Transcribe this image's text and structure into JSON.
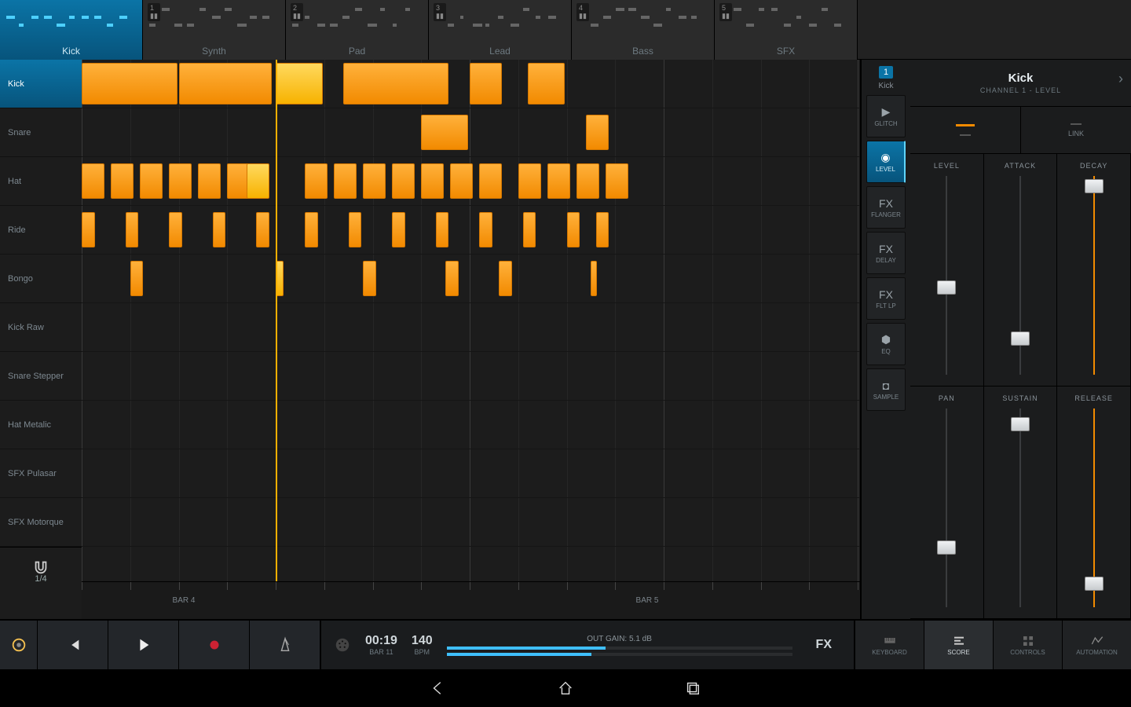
{
  "tracks": [
    "Kick",
    "Synth",
    "Pad",
    "Lead",
    "Bass",
    "SFX"
  ],
  "activeTrack": 0,
  "lanes": [
    "Kick",
    "Snare",
    "Hat",
    "Ride",
    "Bongo",
    "Kick Raw",
    "Snare Stepper",
    "Hat Metalic",
    "SFX Pulasar",
    "SFX Motorque"
  ],
  "activeLane": 0,
  "snap": "1/4",
  "ruler": {
    "labels": [
      "BAR  4",
      "BAR  5"
    ],
    "positions": [
      130,
      720
    ]
  },
  "playheadX": 247,
  "gridWidth": 988,
  "beats": 16,
  "stepWidth": 61.75,
  "steps": {
    "Kick": [
      {
        "i": 0,
        "w": 2
      },
      {
        "i": 2,
        "w": 2,
        "gap": 5
      },
      {
        "i": 4,
        "w": 1,
        "hi": true
      },
      {
        "i": 5.4,
        "w": 2.2
      },
      {
        "i": 8,
        "w": 0.7
      },
      {
        "i": 9.2,
        "w": 0.8
      }
    ],
    "Snare": [
      {
        "i": 7,
        "w": 1
      },
      {
        "i": 10.4,
        "w": 0.5
      }
    ],
    "Hat": [
      {
        "i": 0,
        "w": 0.5
      },
      {
        "i": 0.6,
        "w": 0.5
      },
      {
        "i": 1.2,
        "w": 0.5
      },
      {
        "i": 1.8,
        "w": 0.5
      },
      {
        "i": 2.4,
        "w": 0.5
      },
      {
        "i": 3,
        "w": 0.5
      },
      {
        "i": 3.4,
        "w": 0.5,
        "hi": true
      },
      {
        "i": 4.6,
        "w": 0.5
      },
      {
        "i": 5.2,
        "w": 0.5
      },
      {
        "i": 5.8,
        "w": 0.5
      },
      {
        "i": 6.4,
        "w": 0.5
      },
      {
        "i": 7,
        "w": 0.5
      },
      {
        "i": 7.6,
        "w": 0.5
      },
      {
        "i": 8.2,
        "w": 0.5
      },
      {
        "i": 9,
        "w": 0.5
      },
      {
        "i": 9.6,
        "w": 0.5
      },
      {
        "i": 10.2,
        "w": 0.5
      },
      {
        "i": 10.8,
        "w": 0.5
      }
    ],
    "Ride": [
      {
        "i": 0,
        "w": 0.3
      },
      {
        "i": 0.9,
        "w": 0.3
      },
      {
        "i": 1.8,
        "w": 0.3
      },
      {
        "i": 2.7,
        "w": 0.3
      },
      {
        "i": 3.6,
        "w": 0.3
      },
      {
        "i": 4.6,
        "w": 0.3
      },
      {
        "i": 5.5,
        "w": 0.3
      },
      {
        "i": 6.4,
        "w": 0.3
      },
      {
        "i": 7.3,
        "w": 0.3
      },
      {
        "i": 8.2,
        "w": 0.3
      },
      {
        "i": 9.1,
        "w": 0.3
      },
      {
        "i": 10,
        "w": 0.3
      },
      {
        "i": 10.6,
        "w": 0.3
      }
    ],
    "Bongo": [
      {
        "i": 1,
        "w": 0.3
      },
      {
        "i": 4,
        "w": 0.2,
        "hi": true
      },
      {
        "i": 5.8,
        "w": 0.3
      },
      {
        "i": 7.5,
        "w": 0.3
      },
      {
        "i": 8.6,
        "w": 0.3
      },
      {
        "i": 10.5,
        "w": 0.15
      }
    ]
  },
  "channel": {
    "number": "1",
    "name": "Kick"
  },
  "chanButtons": [
    {
      "id": "glitch",
      "label": "GLITCH",
      "icon": "▶"
    },
    {
      "id": "level",
      "label": "LEVEL",
      "icon": "◉",
      "selected": true
    },
    {
      "id": "fx-flanger",
      "label": "FLANGER",
      "icon": "FX"
    },
    {
      "id": "fx-delay",
      "label": "DELAY",
      "icon": "FX"
    },
    {
      "id": "fx-fltlp",
      "label": "FLT LP",
      "icon": "FX"
    },
    {
      "id": "eq",
      "label": "EQ",
      "icon": "⬢"
    },
    {
      "id": "sample",
      "label": "SAMPLE",
      "icon": "◘"
    }
  ],
  "paramPanel": {
    "title": "Kick",
    "subtitle": "CHANNEL 1 - LEVEL",
    "linkLabel": "LINK",
    "sliders": [
      {
        "name": "LEVEL",
        "pos": 0.44
      },
      {
        "name": "ATTACK",
        "pos": 0.18
      },
      {
        "name": "DECAY",
        "pos": 0.95,
        "orange": true
      },
      {
        "name": "PAN",
        "pos": 0.3
      },
      {
        "name": "SUSTAIN",
        "pos": 0.92
      },
      {
        "name": "RELEASE",
        "pos": 0.12,
        "orange": true
      }
    ]
  },
  "transport": {
    "time": "00:19",
    "timeSub": "BAR  11",
    "bpm": "140",
    "bpmSub": "BPM",
    "gainLabel": "OUT  GAIN:  5.1 dB",
    "fx": "FX",
    "views": [
      "KEYBOARD",
      "SCORE",
      "CONTROLS",
      "AUTOMATION"
    ],
    "activeView": 1
  }
}
